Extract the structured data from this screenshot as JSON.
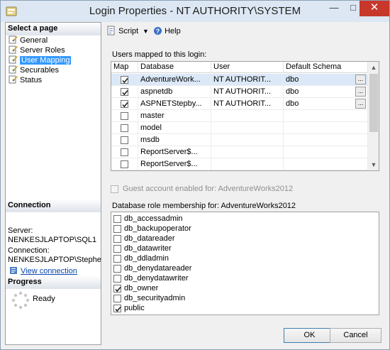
{
  "window": {
    "title": "Login Properties - NT AUTHORITY\\SYSTEM",
    "close_glyph": "✕"
  },
  "left": {
    "select_page_header": "Select a page",
    "pages": [
      {
        "label": "General",
        "icon": "page-wrench-icon",
        "selected": false
      },
      {
        "label": "Server Roles",
        "icon": "page-wrench-icon",
        "selected": false
      },
      {
        "label": "User Mapping",
        "icon": "page-wrench-icon",
        "selected": true
      },
      {
        "label": "Securables",
        "icon": "page-wrench-icon",
        "selected": false
      },
      {
        "label": "Status",
        "icon": "page-wrench-icon",
        "selected": false
      }
    ],
    "connection_header": "Connection",
    "server_label": "Server:",
    "server_value": "NENKESJLAPTOP\\SQL1",
    "connection_label": "Connection:",
    "connection_value": "NENKESJLAPTOP\\Stephe",
    "view_connection": "View connection",
    "progress_header": "Progress",
    "progress_status": "Ready"
  },
  "toolbar": {
    "script_label": "Script",
    "help_label": "Help"
  },
  "mapping": {
    "label": "Users mapped to this login:",
    "columns": [
      "Map",
      "Database",
      "User",
      "Default Schema"
    ],
    "rows": [
      {
        "map": true,
        "database": "AdventureWork...",
        "user": "NT AUTHORIT...",
        "schema": "dbo",
        "has_button": true,
        "selected": true
      },
      {
        "map": true,
        "database": "aspnetdb",
        "user": "NT AUTHORIT...",
        "schema": "dbo",
        "has_button": true,
        "selected": false
      },
      {
        "map": true,
        "database": "ASPNETStepby...",
        "user": "NT AUTHORIT...",
        "schema": "dbo",
        "has_button": true,
        "selected": false
      },
      {
        "map": false,
        "database": "master",
        "user": "",
        "schema": "",
        "has_button": false,
        "selected": false
      },
      {
        "map": false,
        "database": "model",
        "user": "",
        "schema": "",
        "has_button": false,
        "selected": false
      },
      {
        "map": false,
        "database": "msdb",
        "user": "",
        "schema": "",
        "has_button": false,
        "selected": false
      },
      {
        "map": false,
        "database": "ReportServer$...",
        "user": "",
        "schema": "",
        "has_button": false,
        "selected": false
      },
      {
        "map": false,
        "database": "ReportServer$...",
        "user": "",
        "schema": "",
        "has_button": false,
        "selected": false
      }
    ],
    "row_button_label": "...",
    "scroll_position": 0
  },
  "guest": {
    "label": "Guest account enabled for: AdventureWorks2012",
    "checked": false,
    "disabled": true
  },
  "roles": {
    "label": "Database role membership for: AdventureWorks2012",
    "items": [
      {
        "name": "db_accessadmin",
        "checked": false
      },
      {
        "name": "db_backupoperator",
        "checked": false
      },
      {
        "name": "db_datareader",
        "checked": false
      },
      {
        "name": "db_datawriter",
        "checked": false
      },
      {
        "name": "db_ddladmin",
        "checked": false
      },
      {
        "name": "db_denydatareader",
        "checked": false
      },
      {
        "name": "db_denydatawriter",
        "checked": false
      },
      {
        "name": "db_owner",
        "checked": true
      },
      {
        "name": "db_securityadmin",
        "checked": false
      },
      {
        "name": "public",
        "checked": true
      }
    ]
  },
  "buttons": {
    "ok": "OK",
    "cancel": "Cancel"
  }
}
